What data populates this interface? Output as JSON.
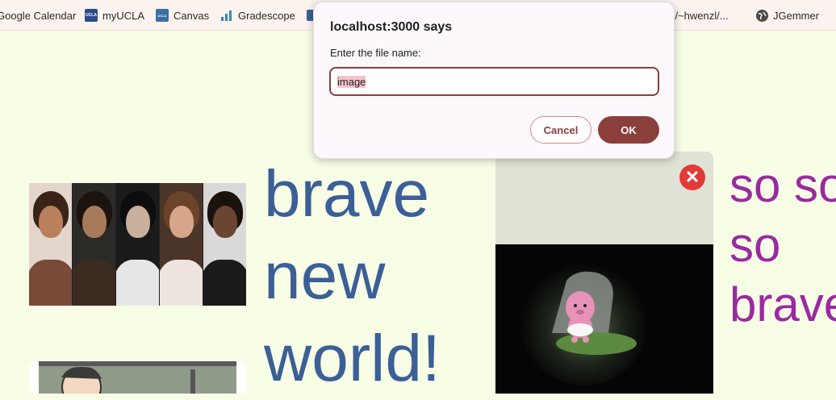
{
  "bookmarks": {
    "google_calendar": "Google Calendar",
    "myucla": "myUCLA",
    "canvas": "Canvas",
    "gradescope": "Gradescope",
    "hwenzl": "of /~hwenzl/...",
    "jgemmer": "JGemmer",
    "ucla_badge": "UCLA"
  },
  "page": {
    "brave_text": "brave new world!",
    "purple_text": "so so\nso\nbrave",
    "close_symbol": "✕"
  },
  "dialog": {
    "title": "localhost:3000 says",
    "message": "Enter the file name:",
    "input_value": "image",
    "cancel_label": "Cancel",
    "ok_label": "OK"
  },
  "colors": {
    "background": "#f8fde6",
    "brave_text": "#3b5f96",
    "purple_text": "#9a2aa1",
    "accent": "#8b3f3a",
    "close_button": "#e23a37"
  }
}
